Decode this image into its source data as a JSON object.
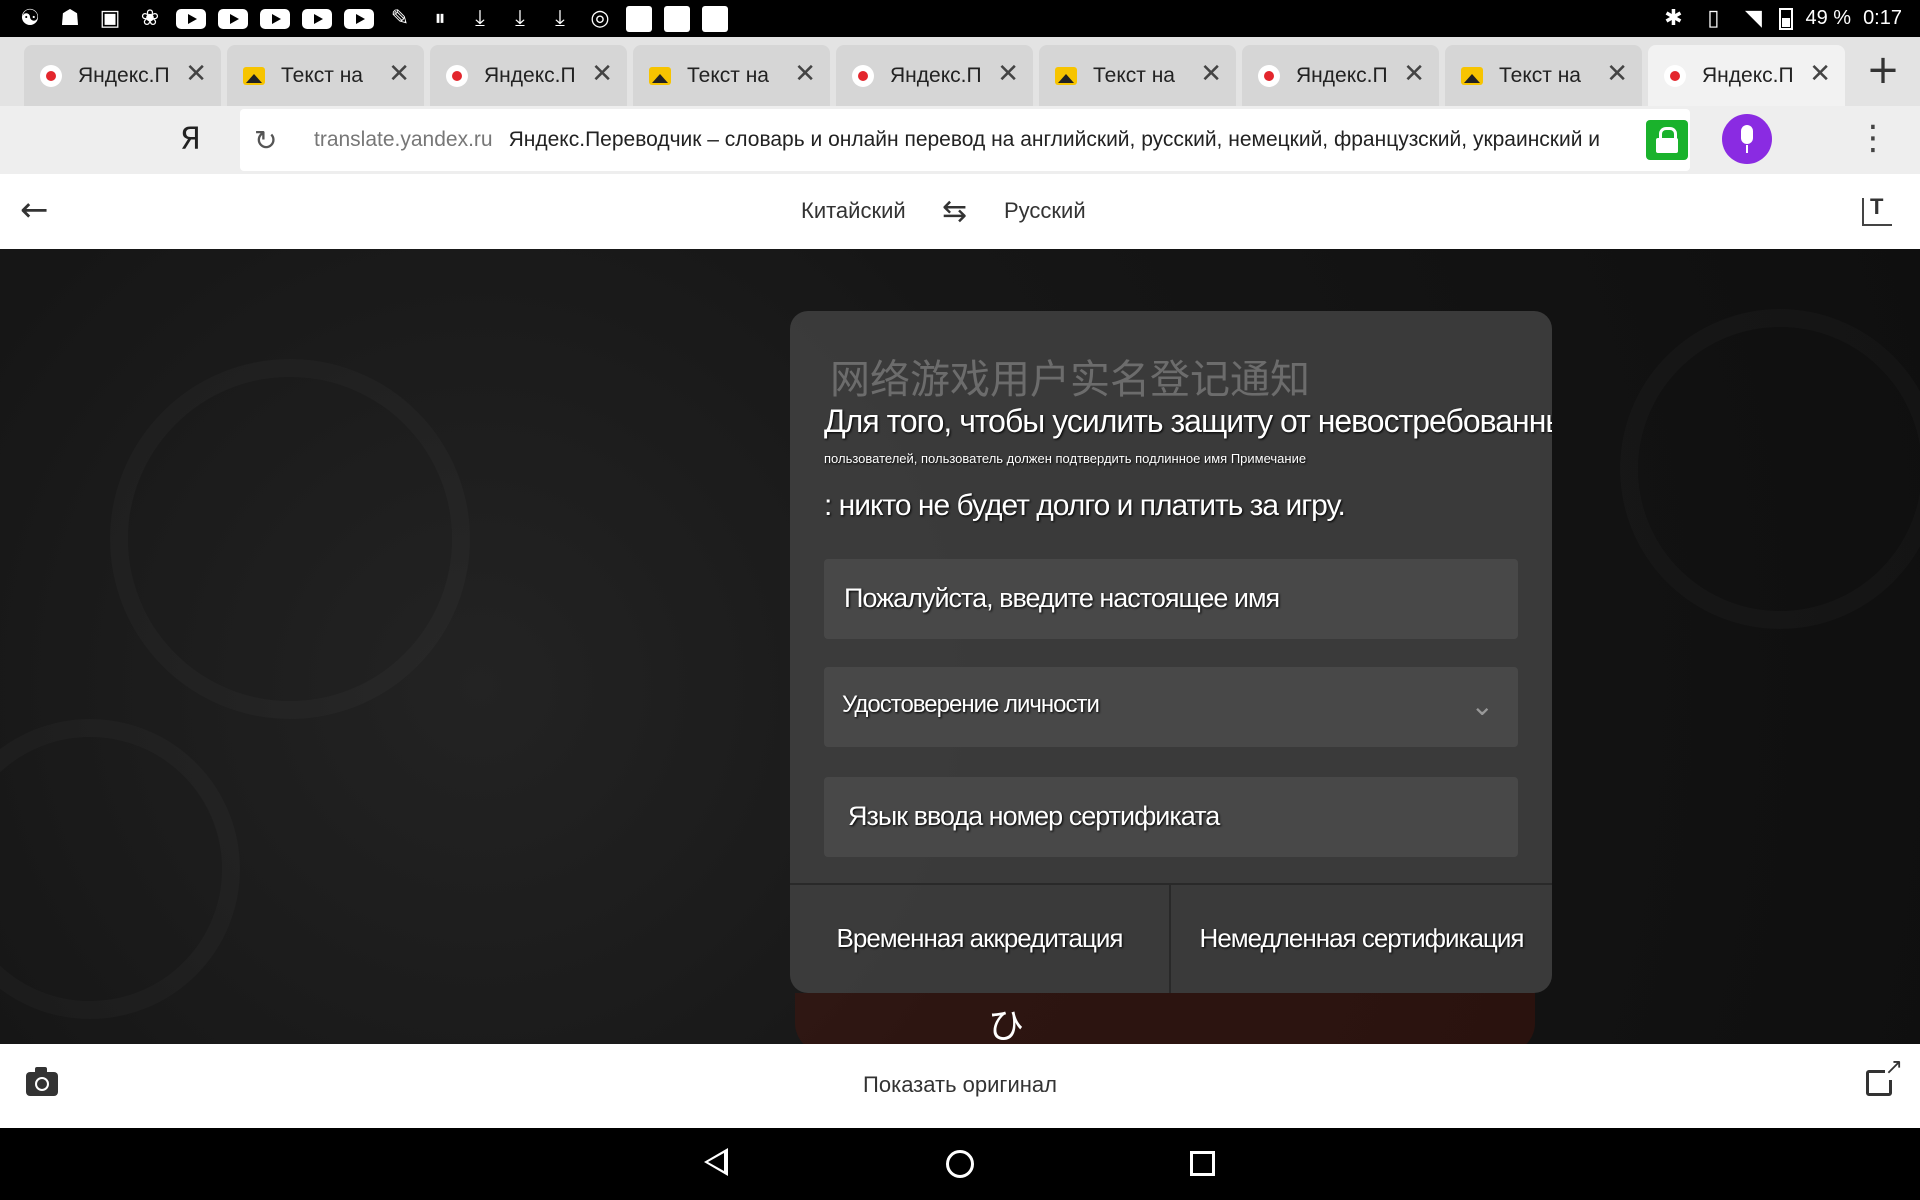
{
  "status_bar": {
    "left_icons": [
      "sync-icon",
      "robot-icon",
      "image-icon",
      "paw-icon",
      "youtube-icon",
      "youtube-icon",
      "youtube-icon",
      "youtube-icon",
      "youtube-icon",
      "broom-icon",
      "pause-icon",
      "download-icon",
      "download-icon",
      "download-icon",
      "instagram-icon",
      "square-icon",
      "square-icon",
      "square-icon"
    ],
    "battery": "49 %",
    "time": "0:17"
  },
  "tabs": [
    {
      "title": "Яндекс.П",
      "icon": "yandex-icon",
      "active": false
    },
    {
      "title": "Текст на",
      "icon": "image-icon",
      "active": false
    },
    {
      "title": "Яндекс.П",
      "icon": "yandex-icon",
      "active": false
    },
    {
      "title": "Текст на",
      "icon": "image-icon",
      "active": false
    },
    {
      "title": "Яндекс.П",
      "icon": "yandex-icon",
      "active": false
    },
    {
      "title": "Текст на",
      "icon": "image-icon",
      "active": false
    },
    {
      "title": "Яндекс.П",
      "icon": "yandex-icon",
      "active": false
    },
    {
      "title": "Текст на",
      "icon": "image-icon",
      "active": false
    },
    {
      "title": "Яндекс.П",
      "icon": "yandex-icon",
      "active": true
    }
  ],
  "address_bar": {
    "logo": "Я",
    "domain": "translate.yandex.ru",
    "page_title": "Яндекс.Переводчик – словарь и онлайн перевод на английский, русский, немецкий, французский, украинский и",
    "lock_color": "#1ab22c",
    "mic_color": "#8a2be2"
  },
  "translator": {
    "source_language": "Китайский",
    "target_language": "Русский",
    "show_original": "Показать оригинал"
  },
  "image_overlay": {
    "original_title": "网络游戏用户实名登记通知",
    "line1": "Для того, чтобы усилить защиту от невостребованных",
    "line2": "пользователей, пользователь должен подтвердить подлинное имя Примечание",
    "line3": ": никто не будет долго и платить за игру.",
    "field_name": "Пожалуйста, введите настоящее имя",
    "field_doc": "Удостоверение личности",
    "field_number": "Язык ввода номер сертификата",
    "button_left": "Временная аккредитация",
    "button_right": "Немедленная сертификация",
    "mark": "ひ"
  }
}
